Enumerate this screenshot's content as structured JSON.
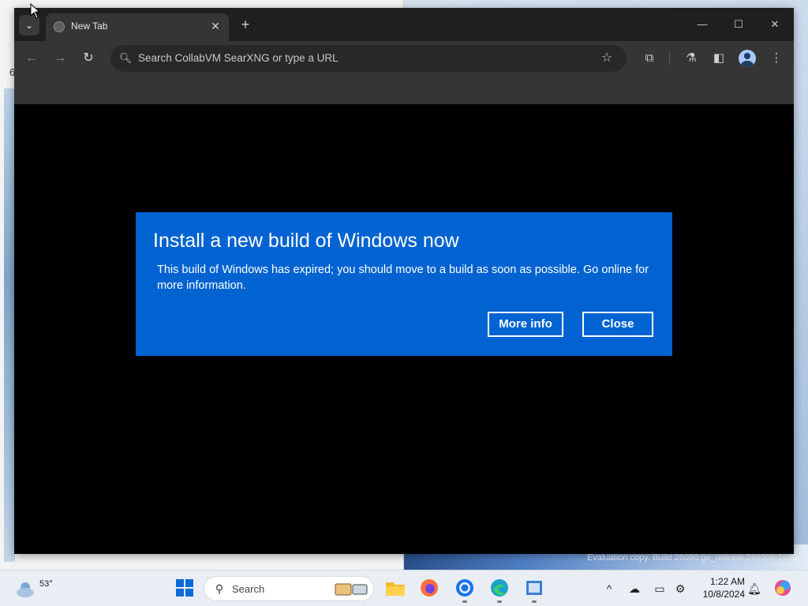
{
  "browser": {
    "tab_title": "New Tab",
    "omnibox_placeholder": "Search CollabVM SearXNG or type a URL"
  },
  "dialog": {
    "title": "Install a new build of Windows now",
    "body": "This build of Windows has expired; you should move to a build as soon as possible. Go online for more information.",
    "more_info_label": "More info",
    "close_label": "Close"
  },
  "desktop": {
    "watermark": "Evaluation copy. Build 26080.ge_release.240308-1400"
  },
  "taskbar": {
    "weather_temp": "53°",
    "search_label": "Search",
    "clock_time": "1:22 AM",
    "clock_date": "10/8/2024"
  },
  "colors": {
    "dialog_bg": "#0063d1",
    "browser_chrome": "#1f1f1f",
    "toolbar": "#353535"
  }
}
